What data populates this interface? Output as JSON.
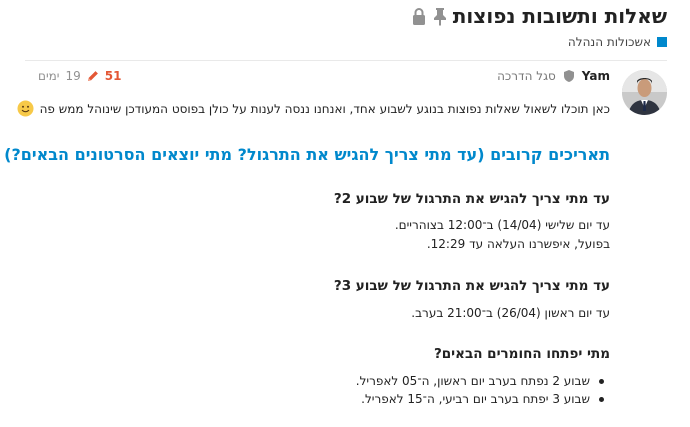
{
  "topic": {
    "title": "שאלות ותשובות נפוצות",
    "category": "אשכולות הנהלה",
    "category_color": "#0088cc",
    "lock_icon": "lock-icon",
    "pin_icon": "pin-icon"
  },
  "post": {
    "username": "Yam",
    "user_title": "סגל הדרכה",
    "likes": "51",
    "age_num": "19",
    "age_unit": "ימים",
    "intro": "כאן תוכלו לשאול שאלות נפוצות בנוגע לשבוע אחד, ואנחנו ננסה לענות על כולן בפוסט המעודכן שינוהל ממש פה",
    "heading": "תאריכים קרובים (עד מתי צריך להגיש את התרגול? מתי יוצאים הסרטונים הבאים?)",
    "sections": [
      {
        "question": "עד מתי צריך להגיש את התרגול של שבוע 2?",
        "lines": [
          "עד יום שלישי (14/04) ב־12:00 בצוהריים.",
          "בפועל, איפשרנו העלאה עד 12:29."
        ]
      },
      {
        "question": "עד מתי צריך להגיש את התרגול של שבוע 3?",
        "lines": [
          "עד יום ראשון (26/04) ב־21:00 בערב."
        ]
      },
      {
        "question": "מתי יפתחו החומרים הבאים?",
        "bullets": [
          "שבוע 2 נפתח בערב יום ראשון, ה־05 לאפריל.",
          "שבוע 3 יפתח בערב יום רביעי, ה־15 לאפריל."
        ]
      }
    ]
  }
}
